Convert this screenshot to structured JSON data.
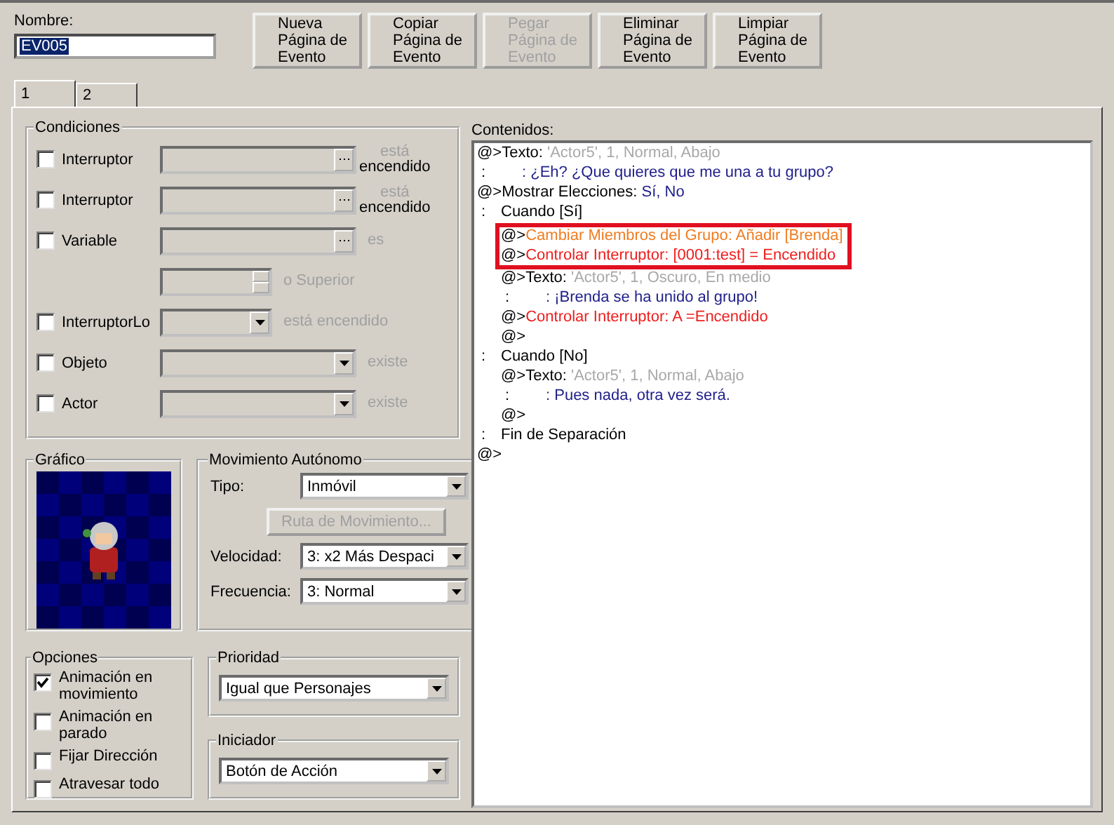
{
  "name_field": {
    "label": "Nombre:",
    "value": "EV005",
    "text_selected": true
  },
  "page_buttons": [
    {
      "label": "Nueva\nPágina de\nEvento",
      "disabled": false
    },
    {
      "label": "Copiar\nPágina de\nEvento",
      "disabled": false
    },
    {
      "label": "Pegar\nPágina de\nEvento",
      "disabled": true
    },
    {
      "label": "Eliminar\nPágina de\nEvento",
      "disabled": false
    },
    {
      "label": "Limpiar\nPágina de\nEvento",
      "disabled": false
    }
  ],
  "tabs": [
    {
      "label": "1",
      "selected": true
    },
    {
      "label": "2",
      "selected": false
    }
  ],
  "conditions": {
    "title": "Condiciones",
    "rows": [
      {
        "kind": "switch",
        "checked": false,
        "label": "Interruptor",
        "suffix": [
          {
            "text": "está",
            "disabled": true
          },
          {
            "text": "encendido",
            "disabled": false
          }
        ]
      },
      {
        "kind": "switch",
        "checked": false,
        "label": "Interruptor",
        "suffix": [
          {
            "text": "está",
            "disabled": true
          },
          {
            "text": "encendido",
            "disabled": false
          }
        ]
      },
      {
        "kind": "switch",
        "checked": false,
        "label": "Variable",
        "suffix": [
          {
            "text": "es",
            "disabled": true
          }
        ]
      },
      {
        "kind": "number",
        "suffix": [
          {
            "text": "o Superior",
            "disabled": true
          }
        ]
      },
      {
        "kind": "small_select",
        "checked": false,
        "label": "InterruptorLo",
        "suffix": [
          {
            "text": "está encendido",
            "disabled": true
          }
        ]
      },
      {
        "kind": "select",
        "checked": false,
        "label": "Objeto",
        "suffix": [
          {
            "text": "existe",
            "disabled": true
          }
        ]
      },
      {
        "kind": "select",
        "checked": false,
        "label": "Actor",
        "suffix": [
          {
            "text": "existe",
            "disabled": true
          }
        ]
      }
    ]
  },
  "graphic": {
    "title": "Gráfico",
    "kind": "picture"
  },
  "movement": {
    "title": "Movimiento Autónomo",
    "rows": [
      {
        "kind": "select",
        "label": "Tipo:",
        "value": "Inmóvil"
      },
      {
        "kind": "button",
        "label": "Ruta de Movimiento...",
        "disabled": true
      },
      {
        "kind": "select",
        "label": "Velocidad:",
        "value": "3: x2 Más Despaci"
      },
      {
        "kind": "select",
        "label": "Frecuencia:",
        "value": "3: Normal"
      }
    ]
  },
  "options": {
    "title": "Opciones",
    "items": [
      {
        "label": "Animación en movimiento",
        "checked": true
      },
      {
        "label": "Animación en parado",
        "checked": false
      },
      {
        "label": "Fijar Dirección",
        "checked": false
      },
      {
        "label": "Atravesar todo",
        "checked": false
      }
    ]
  },
  "priority": {
    "title": "Prioridad",
    "value": "Igual que Personajes"
  },
  "trigger": {
    "title": "Iniciador",
    "value": "Botón de Acción"
  },
  "contents": {
    "title": "Contenidos:",
    "lines": [
      {
        "kind": "command",
        "highlighted": false,
        "segments": [
          {
            "text": "@>Texto: ",
            "color": "#000000"
          },
          {
            "text": "'Actor5', 1, Normal, Abajo",
            "color": "#a8a8a8"
          }
        ]
      },
      {
        "kind": "continuation",
        "highlighted": false,
        "segments": [
          {
            "text": ":",
            "color": "#000000"
          },
          {
            "text": ": ¿Eh? ¿Que quieres que me una a tu grupo?",
            "color": "#20208c"
          }
        ]
      },
      {
        "kind": "command",
        "highlighted": false,
        "segments": [
          {
            "text": "@>Mostrar Elecciones: ",
            "color": "#000000"
          },
          {
            "text": "Sí, No",
            "color": "#20208c"
          }
        ],
        "children": [
          {
            "kind": "branch",
            "highlighted": false,
            "segments": [
              {
                "text": ":",
                "color": "#000000"
              },
              {
                "text": "Cuando [Sí]",
                "color": "#000000"
              }
            ],
            "children": [
              {
                "kind": "command",
                "highlighted": true,
                "segments": [
                  {
                    "text": "@>",
                    "color": "#000000"
                  },
                  {
                    "text": "Cambiar Miembros del Grupo: Añadir [Brenda]",
                    "color": "#f07c20"
                  }
                ]
              },
              {
                "kind": "command",
                "highlighted": true,
                "segments": [
                  {
                    "text": "@>",
                    "color": "#000000"
                  },
                  {
                    "text": "Controlar Interruptor: [0001:test] = Encendido",
                    "color": "#f01c1c"
                  }
                ]
              },
              {
                "kind": "command",
                "highlighted": false,
                "segments": [
                  {
                    "text": "@>Texto: ",
                    "color": "#000000"
                  },
                  {
                    "text": "'Actor5', 1, Oscuro, En medio",
                    "color": "#a8a8a8"
                  }
                ]
              },
              {
                "kind": "continuation",
                "highlighted": false,
                "segments": [
                  {
                    "text": ":",
                    "color": "#000000"
                  },
                  {
                    "text": ": ¡Brenda se ha unido al grupo!",
                    "color": "#20208c"
                  }
                ]
              },
              {
                "kind": "command",
                "highlighted": false,
                "segments": [
                  {
                    "text": "@>",
                    "color": "#000000"
                  },
                  {
                    "text": "Controlar Interruptor: A =Encendido",
                    "color": "#f01c1c"
                  }
                ]
              },
              {
                "kind": "command",
                "highlighted": false,
                "segments": [
                  {
                    "text": "@>",
                    "color": "#000000"
                  }
                ]
              }
            ]
          },
          {
            "kind": "branch",
            "highlighted": false,
            "segments": [
              {
                "text": ":",
                "color": "#000000"
              },
              {
                "text": "Cuando [No]",
                "color": "#000000"
              }
            ],
            "children": [
              {
                "kind": "command",
                "highlighted": false,
                "segments": [
                  {
                    "text": "@>Texto: ",
                    "color": "#000000"
                  },
                  {
                    "text": "'Actor5', 1, Normal, Abajo",
                    "color": "#a8a8a8"
                  }
                ]
              },
              {
                "kind": "continuation",
                "highlighted": false,
                "segments": [
                  {
                    "text": ":",
                    "color": "#000000"
                  },
                  {
                    "text": ": Pues nada, otra vez será.",
                    "color": "#20208c"
                  }
                ]
              },
              {
                "kind": "command",
                "highlighted": false,
                "segments": [
                  {
                    "text": "@>",
                    "color": "#000000"
                  }
                ]
              }
            ]
          },
          {
            "kind": "branch",
            "highlighted": false,
            "segments": [
              {
                "text": ":",
                "color": "#000000"
              },
              {
                "text": "Fin de Separación",
                "color": "#000000"
              }
            ]
          }
        ]
      },
      {
        "kind": "command",
        "highlighted": false,
        "segments": [
          {
            "text": "@>",
            "color": "#000000"
          }
        ]
      }
    ]
  }
}
